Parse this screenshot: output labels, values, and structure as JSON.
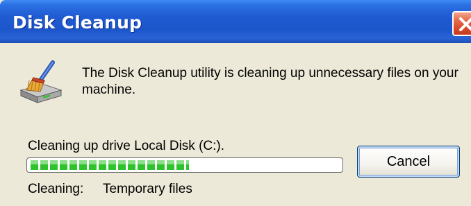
{
  "window": {
    "title": "Disk Cleanup",
    "close_icon": "close-icon"
  },
  "message": "The Disk Cleanup utility is cleaning up unnecessary files on your machine.",
  "app_icon": "disk-cleanup-broom-icon",
  "progress": {
    "label": "Cleaning up drive Local Disk (C:).",
    "fraction": 0.51
  },
  "cancel_label": "Cancel",
  "status": {
    "label": "Cleaning:",
    "value": "Temporary files"
  },
  "colors": {
    "titlebar": "#1f5ad1",
    "dialog_bg": "#ece9d8",
    "progress_fill": "#2ec32b",
    "close_button": "#d84a2a"
  }
}
